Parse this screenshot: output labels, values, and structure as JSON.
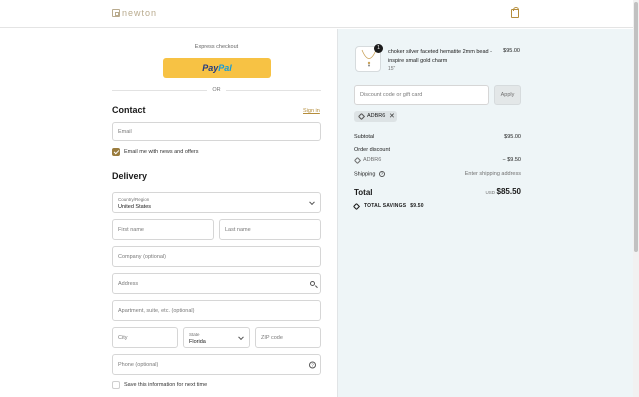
{
  "header": {
    "logo_text": "newton",
    "cart_icon": "shopping-bag-icon"
  },
  "express": {
    "title": "Express checkout",
    "paypal_pay": "Pay",
    "paypal_pal": "Pal",
    "or": "OR"
  },
  "contact": {
    "title": "Contact",
    "sign_in": "Sign in",
    "email_placeholder": "Email",
    "news_label": "Email me with news and offers",
    "news_checked": true
  },
  "delivery": {
    "title": "Delivery",
    "country_label": "Country/Region",
    "country_value": "United States",
    "first_name": "First name",
    "last_name": "Last name",
    "company": "Company (optional)",
    "address": "Address",
    "apartment": "Apartment, suite, etc. (optional)",
    "city": "City",
    "state_label": "State",
    "state_value": "Florida",
    "zip": "ZIP code",
    "phone": "Phone (optional)",
    "save_label": "Save this information for next time",
    "save_checked": false
  },
  "summary": {
    "item": {
      "quantity": "1",
      "name": "choker silver faceted hematite 2mm bead - inspire small gold charm",
      "variant": "15\"",
      "price": "$95.00"
    },
    "discount_placeholder": "Discount code or gift card",
    "apply_label": "Apply",
    "applied_code": "ADBR6",
    "subtotal_label": "Subtotal",
    "subtotal_value": "$95.00",
    "order_discount_label": "Order discount",
    "discount_code": "ADBR6",
    "discount_value": "− $9.50",
    "shipping_label": "Shipping",
    "shipping_value": "Enter shipping address",
    "total_label": "Total",
    "currency": "USD",
    "total_value": "$85.50",
    "savings_label": "TOTAL SAVINGS",
    "savings_value": "$9.50"
  },
  "colors": {
    "accent": "#b58d3b",
    "paypal_yellow": "#f7c244",
    "summary_bg": "#eef5f7"
  }
}
